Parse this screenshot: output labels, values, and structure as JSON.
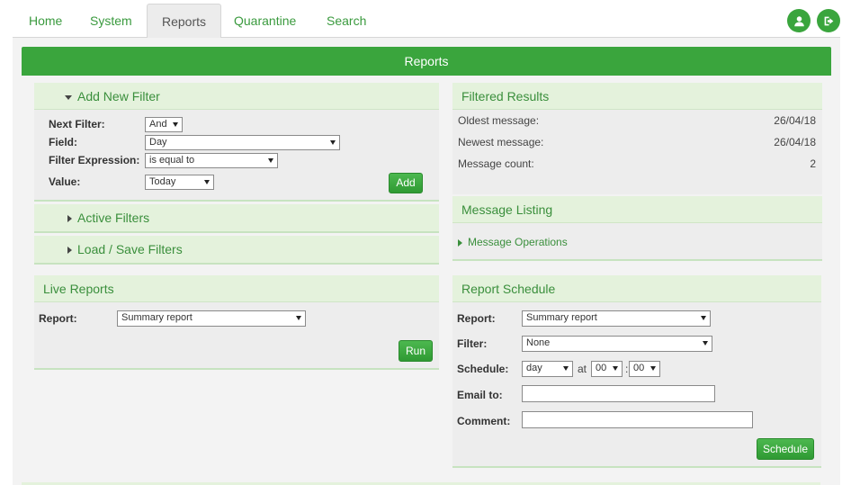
{
  "nav": {
    "tabs": [
      {
        "label": "Home"
      },
      {
        "label": "System"
      },
      {
        "label": "Reports"
      },
      {
        "label": "Quarantine"
      },
      {
        "label": "Search"
      }
    ],
    "active_tab": "Reports",
    "user_icon": "user-icon",
    "logout_icon": "logout-icon"
  },
  "banner": {
    "title": "Reports"
  },
  "add_filter": {
    "title": "Add New Filter",
    "next_filter_label": "Next Filter:",
    "next_filter_value": "And",
    "field_label": "Field:",
    "field_value": "Day",
    "expression_label": "Filter Expression:",
    "expression_value": "is equal to",
    "value_label": "Value:",
    "value_value": "Today",
    "add_button": "Add"
  },
  "active_filters": {
    "title": "Active Filters"
  },
  "load_save": {
    "title": "Load / Save Filters"
  },
  "live_reports": {
    "title": "Live Reports",
    "report_label": "Report:",
    "report_value": "Summary report",
    "run_button": "Run"
  },
  "filtered_results": {
    "title": "Filtered Results",
    "rows": [
      {
        "label": "Oldest message:",
        "value": "26/04/18"
      },
      {
        "label": "Newest message:",
        "value": "26/04/18"
      },
      {
        "label": "Message count:",
        "value": "2"
      }
    ]
  },
  "message_listing": {
    "title": "Message Listing",
    "operations": "Message Operations"
  },
  "report_schedule": {
    "title": "Report Schedule",
    "report_label": "Report:",
    "report_value": "Summary report",
    "filter_label": "Filter:",
    "filter_value": "None",
    "schedule_label": "Schedule:",
    "schedule_value": "day",
    "at_text": "at",
    "hour_value": "00",
    "colon": ":",
    "minute_value": "00",
    "email_label": "Email to:",
    "email_value": "",
    "comment_label": "Comment:",
    "comment_value": "",
    "schedule_button": "Schedule"
  },
  "colors": {
    "accent": "#3aa53d",
    "panel_header": "#e4f2dc",
    "link": "#3a9a3e"
  }
}
